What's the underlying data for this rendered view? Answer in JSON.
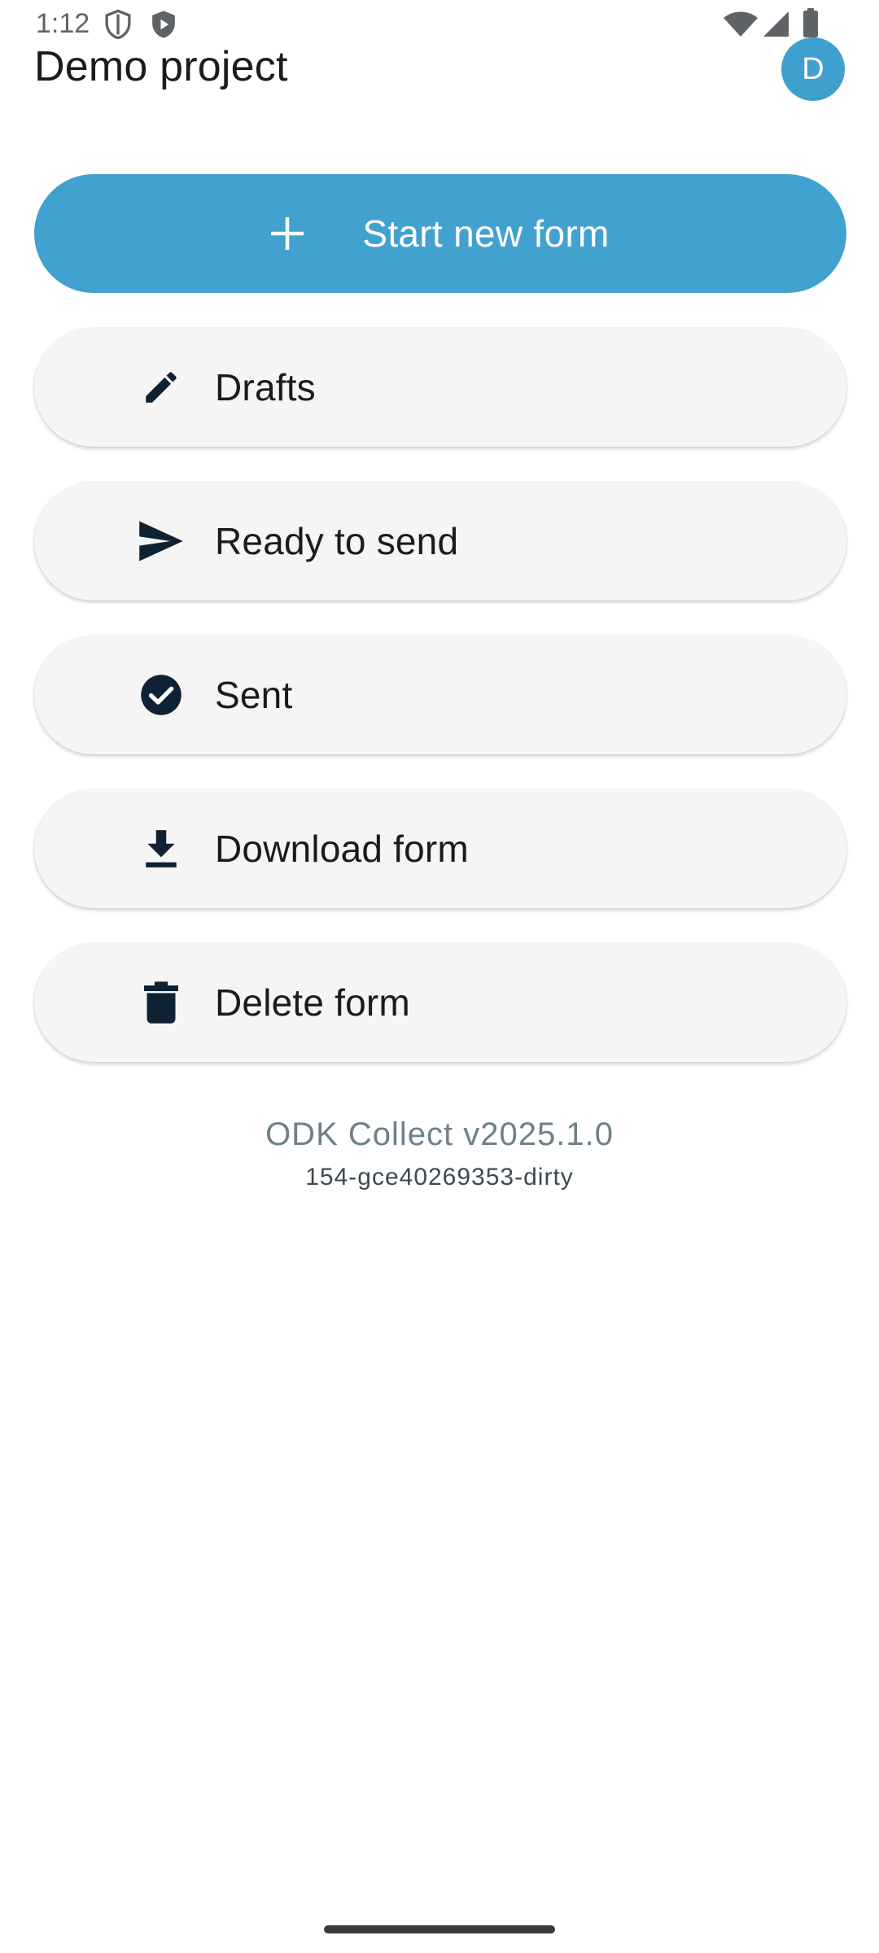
{
  "status_bar": {
    "time": "1:12",
    "icons": [
      "shield-outline-icon",
      "shield-play-icon",
      "wifi-icon",
      "signal-icon",
      "battery-icon"
    ]
  },
  "header": {
    "title": "Demo project",
    "avatar_letter": "D"
  },
  "actions": {
    "start_new_form": {
      "label": "Start new form",
      "icon": "plus-icon"
    },
    "drafts": {
      "label": "Drafts",
      "icon": "pencil-icon"
    },
    "ready_to_send": {
      "label": "Ready to send",
      "icon": "send-icon"
    },
    "sent": {
      "label": "Sent",
      "icon": "check-circle-icon"
    },
    "download_form": {
      "label": "Download form",
      "icon": "download-icon"
    },
    "delete_form": {
      "label": "Delete form",
      "icon": "trash-icon"
    }
  },
  "footer": {
    "version": "ODK Collect v2025.1.0",
    "build": "154-gce40269353-dirty"
  },
  "colors": {
    "primary": "#41a1cf",
    "button_bg": "#f5f5f5",
    "icon_dark": "#0f2233",
    "version_text": "#6e8089"
  }
}
